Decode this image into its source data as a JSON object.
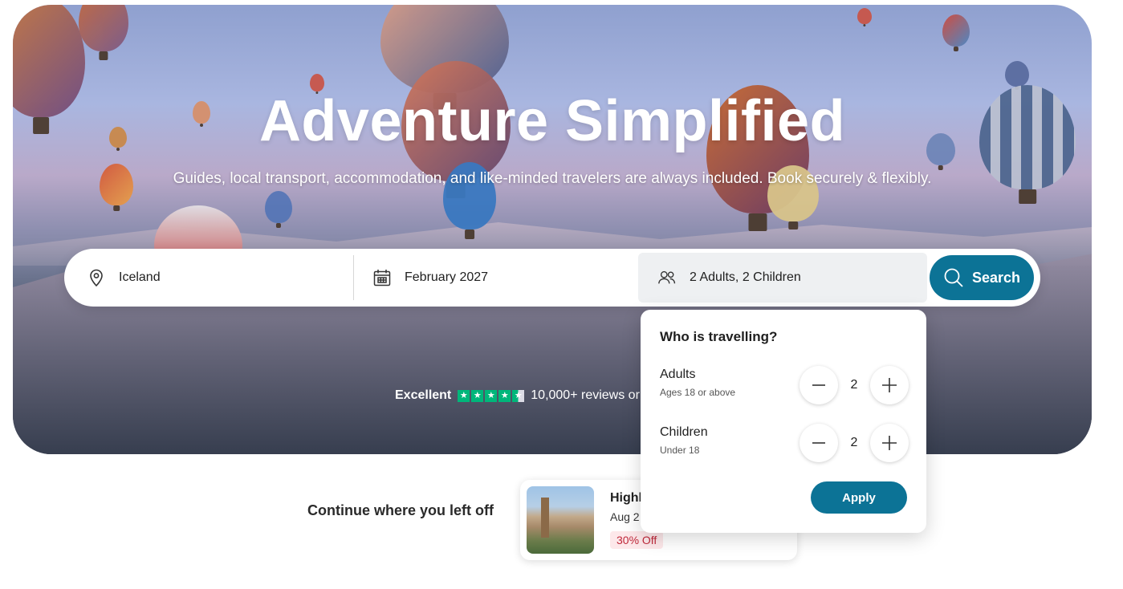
{
  "hero": {
    "title": "Adventure Simplified",
    "subtitle": "Guides, local transport, accommodation, and like-minded travelers are always included. Book securely & flexibly."
  },
  "search": {
    "destination_value": "Iceland",
    "date_value": "February 2027",
    "travellers_value": "2 Adults, 2 Children",
    "search_label": "Search"
  },
  "rating": {
    "label": "Excellent",
    "stars": 4.5,
    "reviews_text": "10,000+ reviews or"
  },
  "travellers_popover": {
    "heading": "Who is travelling?",
    "adults": {
      "label": "Adults",
      "sublabel": "Ages 18 or above",
      "count": "2"
    },
    "children": {
      "label": "Children",
      "sublabel": "Under 18",
      "count": "2"
    },
    "apply_label": "Apply"
  },
  "continue": {
    "label": "Continue where you left off",
    "card": {
      "title": "Highl",
      "date": "Aug 2",
      "badge": "30% Off"
    }
  },
  "colors": {
    "accent": "#0c7396",
    "trustpilot_green": "#00b67a",
    "discount_text": "#c0283a"
  },
  "icons": [
    "location-pin-icon",
    "calendar-icon",
    "people-icon",
    "search-icon",
    "minus-icon",
    "plus-icon",
    "star-icon"
  ]
}
